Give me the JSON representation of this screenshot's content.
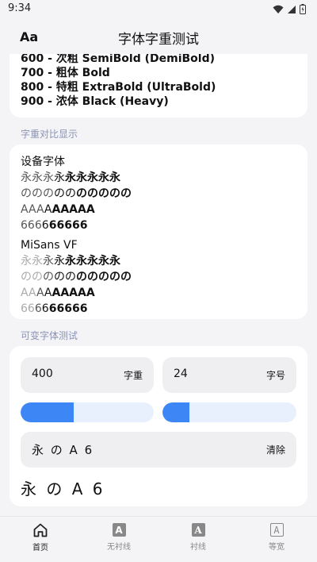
{
  "status": {
    "time": "9:34"
  },
  "app": {
    "logo": "Aa",
    "title": "字体字重测试"
  },
  "weights_partial": [
    {
      "label": "600 - 次粗 SemiBold (DemiBold)",
      "weight": 600
    },
    {
      "label": "700 - 粗体 Bold",
      "weight": 700
    },
    {
      "label": "800 - 特粗 ExtraBold (UltraBold)",
      "weight": 800
    },
    {
      "label": "900 - 浓体 Black (Heavy)",
      "weight": 900
    }
  ],
  "compare": {
    "section_label": "字重对比显示",
    "device": {
      "title": "设备字体",
      "rows": [
        [
          "永",
          "永",
          "永",
          "永",
          "永",
          "永",
          "永",
          "永",
          "永"
        ],
        [
          "の",
          "の",
          "の",
          "の",
          "の",
          "の",
          "の",
          "の",
          "の",
          "の"
        ],
        [
          "A",
          "A",
          "A",
          "A",
          "A",
          "A",
          "A",
          "A",
          "A"
        ],
        [
          "6",
          "6",
          "6",
          "6",
          "6",
          "6",
          "6",
          "6",
          "6"
        ]
      ]
    },
    "misans": {
      "title": "MiSans VF",
      "rows": [
        [
          "永",
          "永",
          "永",
          "永",
          "永",
          "永",
          "永",
          "永",
          "永"
        ],
        [
          "の",
          "の",
          "の",
          "の",
          "の",
          "の",
          "の",
          "の",
          "の",
          "の"
        ],
        [
          "A",
          "A",
          "A",
          "A",
          "A",
          "A",
          "A",
          "A",
          "A"
        ],
        [
          "6",
          "6",
          "6",
          "6",
          "6",
          "6",
          "6",
          "6",
          "6"
        ]
      ]
    }
  },
  "variable": {
    "section_label": "可变字体测试",
    "weight_value": "400",
    "weight_unit": "字重",
    "size_value": "24",
    "size_unit": "字号",
    "weight_slider": 0.4,
    "size_slider": 0.2,
    "preview_text": "永 の A 6",
    "clear_label": "清除",
    "big_preview": "永 の A 6"
  },
  "nav": [
    {
      "label": "首页",
      "icon": "home-icon",
      "active": true
    },
    {
      "label": "无衬线",
      "icon": "sans-font-icon",
      "active": false
    },
    {
      "label": "衬线",
      "icon": "serif-font-icon",
      "active": false
    },
    {
      "label": "等宽",
      "icon": "mono-font-icon",
      "active": false
    }
  ],
  "colors": {
    "accent": "#3d86f5",
    "track": "#e8effd",
    "label": "#8a93b3"
  }
}
